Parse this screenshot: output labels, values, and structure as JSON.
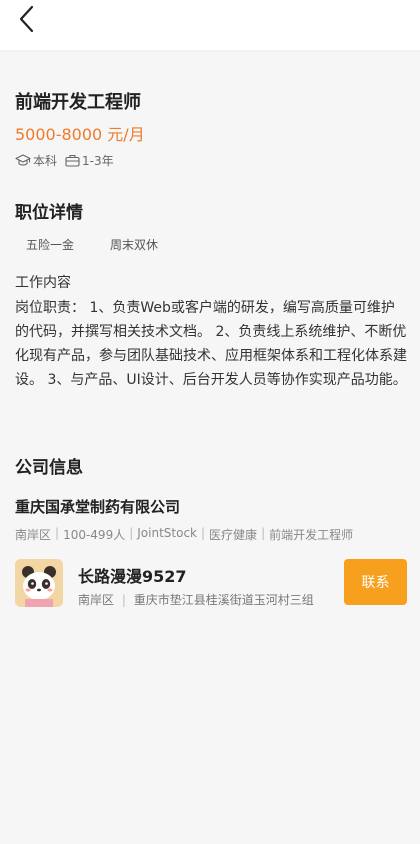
{
  "job": {
    "title": "前端开发工程师",
    "salary": "5000-8000 元/月",
    "education": "本科",
    "experience": "1-3年"
  },
  "details": {
    "section_title": "职位详情",
    "welfare": [
      "五险一金",
      "周末双休"
    ],
    "content_label": "工作内容",
    "content_text": "岗位职责： 1、负责Web或客户端的研发，编写高质量可维护的代码，并撰写相关技术文档。 2、负责线上系统维护、不断优化现有产品，参与团队基础技术、应用框架体系和工程化体系建设。 3、与产品、UI设计、后台开发人员等协作实现产品功能。"
  },
  "company": {
    "section_title": "公司信息",
    "name": "重庆国承堂制药有限公司",
    "meta": [
      "南岸区",
      "100-499人",
      "JointStock",
      "医疗健康",
      "前端开发工程师"
    ]
  },
  "recruiter": {
    "name": "长路漫漫9527",
    "district": "南岸区",
    "address": "重庆市垫江县桂溪街道玉河村三组",
    "contact_label": "联系"
  },
  "icons": {
    "back": "chevron-left-icon",
    "education": "graduation-cap-icon",
    "experience": "briefcase-icon"
  },
  "colors": {
    "salary": "#f07a2a",
    "contact_button": "#f7a01e"
  }
}
